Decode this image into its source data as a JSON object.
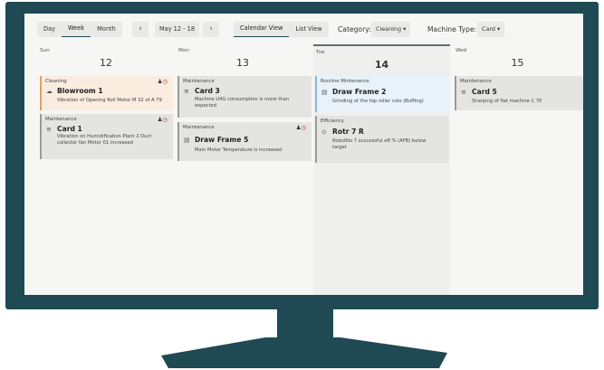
{
  "toolbar": {
    "view_tabs": [
      {
        "label": "Day"
      },
      {
        "label": "Week"
      },
      {
        "label": "Month"
      }
    ],
    "prev_icon": "‹",
    "next_icon": "›",
    "date_range": "May 12 - 18",
    "view_modes": [
      {
        "label": "Calendar View"
      },
      {
        "label": "List View"
      }
    ],
    "category_label": "Category:",
    "category_value": "Cleaning",
    "machine_type_label": "Machine Type:",
    "machine_type_value": "Card"
  },
  "days": [
    {
      "name": "Sun",
      "number": "12"
    },
    {
      "name": "Mon",
      "number": "13"
    },
    {
      "name": "Tue",
      "number": "14"
    },
    {
      "name": "Wed",
      "number": "15"
    }
  ],
  "tasks": {
    "sun": [
      {
        "category": "Cleaning",
        "title": "Blowroom 1",
        "description": "Vibration of Opening Roll Motor M 32 of A 79"
      },
      {
        "category": "Maintenance",
        "title": "Card 1",
        "description": "Vibration on Humidification Plant 2 Duct collector fan Motor 01 increased"
      }
    ],
    "mon": [
      {
        "category": "Maintenance",
        "title": "Card 3",
        "description": "Machine U4G consumption is more than expected"
      },
      {
        "category": "Maintenance",
        "title": "Draw Frame 5",
        "description": "Main Motor Temperature is increased"
      }
    ],
    "tue": [
      {
        "category": "Routine Mintenance",
        "title": "Draw Frame 2",
        "description": "Grinding of the top roller cots (Buffing)"
      },
      {
        "category": "Efficiency",
        "title": "Rotr 7 R",
        "description": "RobotNo 7 successful eff % (AFB) below target"
      }
    ],
    "wed": [
      {
        "category": "Maintenance",
        "title": "Card 5",
        "description": "Sharping of flat machine C 70"
      }
    ]
  },
  "icons": {
    "person": "person-icon",
    "alarm": "alarm-icon",
    "caret": "▾"
  },
  "colors": {
    "monitor": "#1f4953",
    "cleaning_accent": "#e39f62",
    "routine_accent": "#8cb6de",
    "alarm": "#c9252a"
  }
}
